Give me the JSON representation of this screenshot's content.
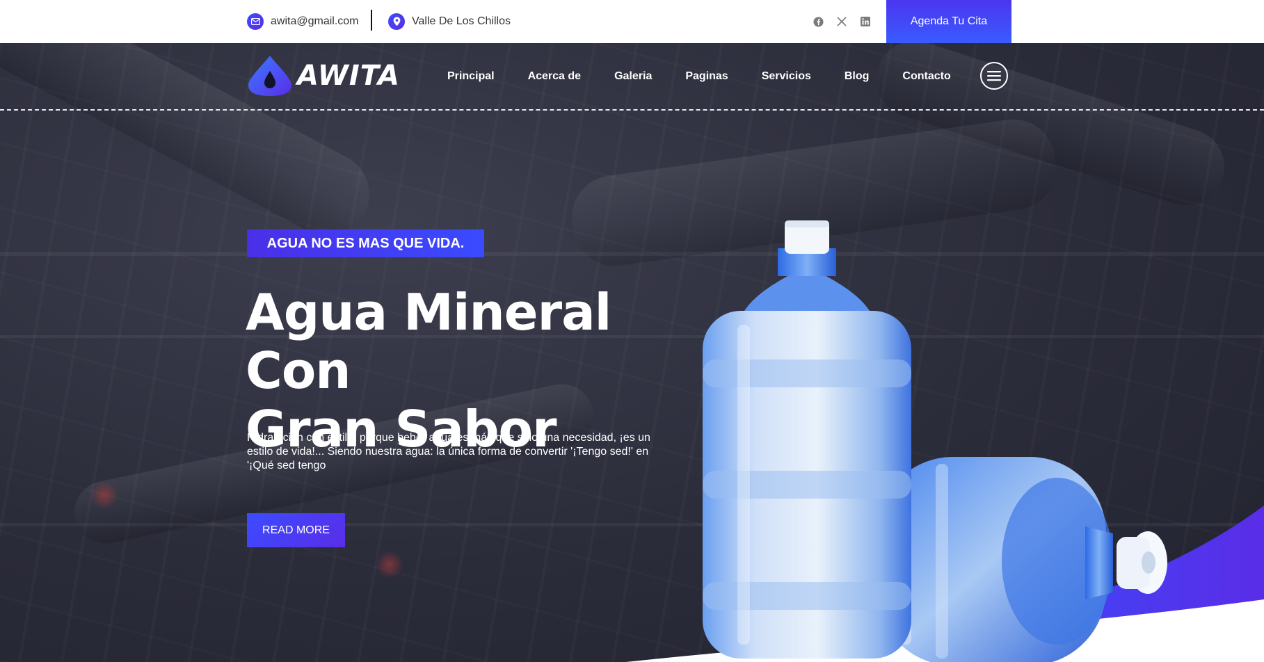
{
  "topbar": {
    "email": "awita@gmail.com",
    "location": "Valle De Los Chillos",
    "socials": [
      "facebook-icon",
      "x-icon",
      "linkedin-icon"
    ],
    "cta_label": "Agenda Tu Cita"
  },
  "nav": {
    "logo_text": "AWITA",
    "links": [
      "Principal",
      "Acerca de",
      "Galeria",
      "Paginas",
      "Servicios",
      "Blog",
      "Contacto"
    ]
  },
  "hero": {
    "tagline": "AGUA NO ES MAS QUE VIDA.",
    "headline_line1": "Agua Mineral Con",
    "headline_line2": "Gran Sabor",
    "description": "Hidratación con estilo: porque beber agua es más que solo una necesidad, ¡es un estilo de vida!... Siendo nuestra agua: la única forma de convertir '¡Tengo sed!' en '¡Qué sed tengo",
    "button_label": "READ MORE"
  },
  "colors": {
    "accent": "#3b4cff",
    "accent_purple": "#5a2de8",
    "dark_bg": "#2b2c3a",
    "white": "#ffffff"
  }
}
